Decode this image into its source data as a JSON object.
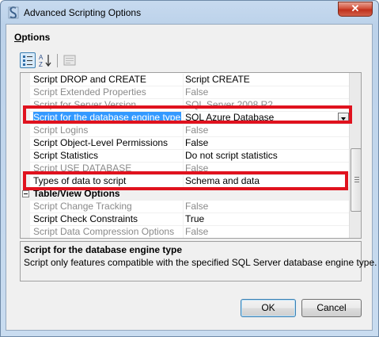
{
  "window": {
    "title": "Advanced Scripting Options",
    "close_glyph": "✕"
  },
  "options_label_first": "O",
  "options_label_rest": "ptions",
  "toolbar": {
    "categorized_icon": "categorized-icon",
    "alphabetical_icon": "sort-az-icon",
    "property_pages_icon": "property-pages-icon"
  },
  "properties": [
    {
      "name": "Script DROP and CREATE",
      "value": "Script CREATE"
    },
    {
      "name": "Script Extended Properties",
      "value": "False"
    },
    {
      "name": "Script for Server Version",
      "value": "SQL Server 2008 R2"
    },
    {
      "name": "Script for the database engine type",
      "value": "SQL Azure Database"
    },
    {
      "name": "Script Logins",
      "value": "False"
    },
    {
      "name": "Script Object-Level Permissions",
      "value": "False"
    },
    {
      "name": "Script Statistics",
      "value": "Do not script statistics"
    },
    {
      "name": "Script USE DATABASE",
      "value": "False"
    },
    {
      "name": "Types of data to script",
      "value": "Schema and data"
    },
    {
      "category": "Table/View Options"
    },
    {
      "name": "Script Change Tracking",
      "value": "False"
    },
    {
      "name": "Script Check Constraints",
      "value": "True"
    },
    {
      "name": "Script Data Compression Options",
      "value": "False"
    }
  ],
  "description": {
    "title": "Script for the database engine type",
    "text": "Script only features compatible with the specified SQL Server database engine type."
  },
  "buttons": {
    "ok": "OK",
    "cancel": "Cancel"
  },
  "colors": {
    "selection": "#3399ff",
    "highlight_box": "#e0121e",
    "disabled_text": "#8a8a8a"
  }
}
